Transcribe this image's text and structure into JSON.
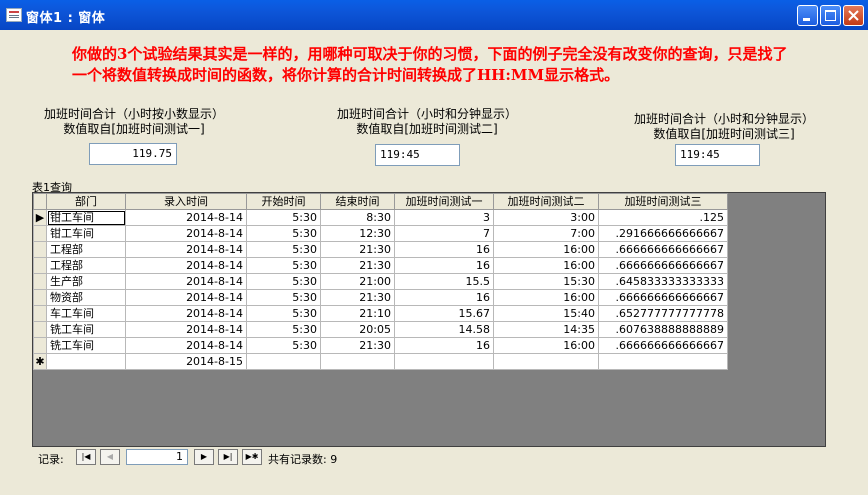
{
  "window": {
    "title": "窗体1 : 窗体"
  },
  "note": "你做的3个试验结果其实是一样的，用哪种可取决于你的习惯，下面的例子完全没有改变你的查询，只是找了一个将数值转换成时间的函数，将你计算的合计时间转换成了HH:MM显示格式。",
  "fields": [
    {
      "label1": "加班时间合计（小时按小数显示）",
      "label2": "数值取自[加班时间测试一]",
      "value": "119.75"
    },
    {
      "label1": "加班时间合计（小时和分钟显示）",
      "label2": "数值取自[加班时间测试二]",
      "value": "119:45"
    },
    {
      "label1": "加班时间合计（小时和分钟显示）",
      "label2": "数值取自[加班时间测试三]",
      "value": "119:45"
    }
  ],
  "subform": {
    "caption": "表1查询",
    "columns": [
      "部门",
      "录入时间",
      "开始时间",
      "结束时间",
      "加班时间测试一",
      "加班时间测试二",
      "加班时间测试三"
    ],
    "rows": [
      [
        "钳工车间",
        "2014-8-14",
        "5:30",
        "8:30",
        "3",
        "3:00",
        ".125"
      ],
      [
        "钳工车间",
        "2014-8-14",
        "5:30",
        "12:30",
        "7",
        "7:00",
        ".291666666666667"
      ],
      [
        "工程部",
        "2014-8-14",
        "5:30",
        "21:30",
        "16",
        "16:00",
        ".666666666666667"
      ],
      [
        "工程部",
        "2014-8-14",
        "5:30",
        "21:30",
        "16",
        "16:00",
        ".666666666666667"
      ],
      [
        "生产部",
        "2014-8-14",
        "5:30",
        "21:00",
        "15.5",
        "15:30",
        ".645833333333333"
      ],
      [
        "物资部",
        "2014-8-14",
        "5:30",
        "21:30",
        "16",
        "16:00",
        ".666666666666667"
      ],
      [
        "车工车间",
        "2014-8-14",
        "5:30",
        "21:10",
        "15.67",
        "15:40",
        ".652777777777778"
      ],
      [
        "铣工车间",
        "2014-8-14",
        "5:30",
        "20:05",
        "14.58",
        "14:35",
        ".607638888888889"
      ],
      [
        "铣工车间",
        "2014-8-14",
        "5:30",
        "21:30",
        "16",
        "16:00",
        ".666666666666667"
      ]
    ],
    "new_row": [
      "",
      "2014-8-15",
      "",
      "",
      "",
      "",
      ""
    ],
    "current_marker": "▶",
    "new_marker": "✱"
  },
  "nav": {
    "label": "记录:",
    "current": "1",
    "total_label": "共有记录数: 9",
    "btn_first": "|◀",
    "btn_prev": "◀",
    "btn_next": "▶",
    "btn_last": "▶|",
    "btn_new": "▶✱"
  }
}
